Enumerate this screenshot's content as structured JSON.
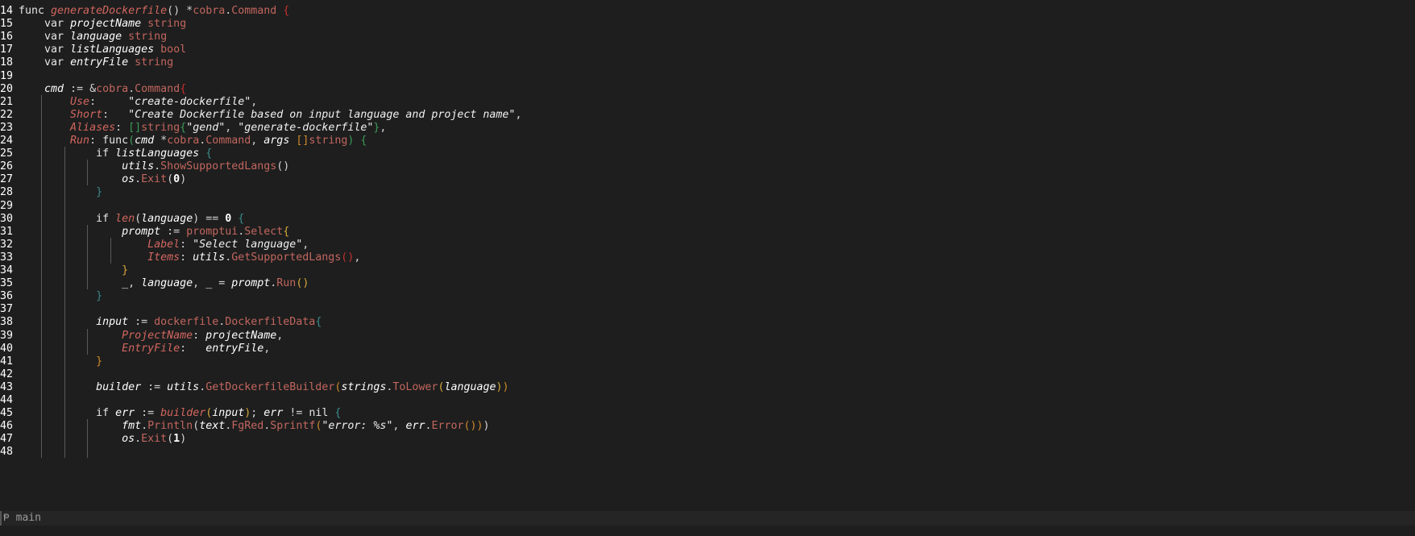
{
  "editor": {
    "language": "go",
    "lines": [
      {
        "n": "14",
        "indent": 0,
        "tokens": [
          [
            "kw",
            "func "
          ],
          [
            "fn",
            "generateDockerfile"
          ],
          [
            "pun",
            "() "
          ],
          [
            "op",
            "*"
          ],
          [
            "pkg",
            "cobra"
          ],
          [
            "pun",
            "."
          ],
          [
            "typ",
            "Command"
          ],
          [
            "b-red",
            " {"
          ]
        ]
      },
      {
        "n": "15",
        "indent": 1,
        "tokens": [
          [
            "kw",
            "var "
          ],
          [
            "var",
            "projectName "
          ],
          [
            "typ",
            "string"
          ]
        ]
      },
      {
        "n": "16",
        "indent": 1,
        "tokens": [
          [
            "kw",
            "var "
          ],
          [
            "var",
            "language "
          ],
          [
            "typ",
            "string"
          ]
        ]
      },
      {
        "n": "17",
        "indent": 1,
        "tokens": [
          [
            "kw",
            "var "
          ],
          [
            "var",
            "listLanguages "
          ],
          [
            "typ",
            "bool"
          ]
        ]
      },
      {
        "n": "18",
        "indent": 1,
        "tokens": [
          [
            "kw",
            "var "
          ],
          [
            "var",
            "entryFile "
          ],
          [
            "typ",
            "string"
          ]
        ]
      },
      {
        "n": "19",
        "indent": 0,
        "tokens": []
      },
      {
        "n": "20",
        "indent": 1,
        "tokens": [
          [
            "var",
            "cmd "
          ],
          [
            "op",
            ":= &"
          ],
          [
            "pkg",
            "cobra"
          ],
          [
            "pun",
            "."
          ],
          [
            "typ",
            "Command"
          ],
          [
            "b-red",
            "{"
          ]
        ]
      },
      {
        "n": "21",
        "indent": 2,
        "tokens": [
          [
            "fld",
            "Use"
          ],
          [
            "pun",
            ":     "
          ],
          [
            "str",
            "\"create-dockerfile\""
          ],
          [
            "pun",
            ","
          ]
        ]
      },
      {
        "n": "22",
        "indent": 2,
        "tokens": [
          [
            "fld",
            "Short"
          ],
          [
            "pun",
            ":   "
          ],
          [
            "str",
            "\"Create Dockerfile based on input language and project name\""
          ],
          [
            "pun",
            ","
          ]
        ]
      },
      {
        "n": "23",
        "indent": 2,
        "tokens": [
          [
            "fld",
            "Aliases"
          ],
          [
            "pun",
            ": "
          ],
          [
            "b-green",
            "[]"
          ],
          [
            "typ",
            "string"
          ],
          [
            "b-green",
            "{"
          ],
          [
            "str",
            "\"gend\""
          ],
          [
            "pun",
            ", "
          ],
          [
            "str",
            "\"generate-dockerfile\""
          ],
          [
            "b-green",
            "}"
          ],
          [
            "pun",
            ","
          ]
        ]
      },
      {
        "n": "24",
        "indent": 2,
        "tokens": [
          [
            "fld",
            "Run"
          ],
          [
            "pun",
            ": "
          ],
          [
            "kw",
            "func"
          ],
          [
            "b-green",
            "("
          ],
          [
            "var",
            "cmd "
          ],
          [
            "op",
            "*"
          ],
          [
            "pkg",
            "cobra"
          ],
          [
            "pun",
            "."
          ],
          [
            "typ",
            "Command"
          ],
          [
            "pun",
            ", "
          ],
          [
            "var",
            "args "
          ],
          [
            "b-orange",
            "[]"
          ],
          [
            "typ",
            "string"
          ],
          [
            "b-green",
            ")"
          ],
          [
            "b-green",
            " {"
          ]
        ]
      },
      {
        "n": "25",
        "indent": 3,
        "tokens": [
          [
            "kw",
            "if "
          ],
          [
            "var",
            "listLanguages "
          ],
          [
            "b-teal",
            "{"
          ]
        ]
      },
      {
        "n": "26",
        "indent": 4,
        "tokens": [
          [
            "var",
            "utils"
          ],
          [
            "pun",
            "."
          ],
          [
            "call",
            "ShowSupportedLangs"
          ],
          [
            "pun",
            "()"
          ]
        ]
      },
      {
        "n": "27",
        "indent": 4,
        "tokens": [
          [
            "var",
            "os"
          ],
          [
            "pun",
            "."
          ],
          [
            "call",
            "Exit"
          ],
          [
            "pun",
            "("
          ],
          [
            "num",
            "0"
          ],
          [
            "pun",
            ")"
          ]
        ]
      },
      {
        "n": "28",
        "indent": 3,
        "tokens": [
          [
            "b-teal",
            "}"
          ]
        ]
      },
      {
        "n": "29",
        "indent": 0,
        "tokens": []
      },
      {
        "n": "30",
        "indent": 3,
        "tokens": [
          [
            "kw",
            "if "
          ],
          [
            "fn",
            "len"
          ],
          [
            "pun",
            "("
          ],
          [
            "var",
            "language"
          ],
          [
            "pun",
            ") == "
          ],
          [
            "num",
            "0"
          ],
          [
            "b-teal",
            " {"
          ]
        ]
      },
      {
        "n": "31",
        "indent": 4,
        "tokens": [
          [
            "var",
            "prompt "
          ],
          [
            "op",
            ":= "
          ],
          [
            "pkg",
            "promptui"
          ],
          [
            "pun",
            "."
          ],
          [
            "call",
            "Select"
          ],
          [
            "b-yellow",
            "{"
          ]
        ]
      },
      {
        "n": "32",
        "indent": 5,
        "tokens": [
          [
            "fld",
            "Label"
          ],
          [
            "pun",
            ": "
          ],
          [
            "str",
            "\"Select language\""
          ],
          [
            "pun",
            ","
          ]
        ]
      },
      {
        "n": "33",
        "indent": 5,
        "tokens": [
          [
            "fld",
            "Items"
          ],
          [
            "pun",
            ": "
          ],
          [
            "var",
            "utils"
          ],
          [
            "pun",
            "."
          ],
          [
            "call",
            "GetSupportedLangs"
          ],
          [
            "b-red",
            "()"
          ],
          [
            "pun",
            ","
          ]
        ]
      },
      {
        "n": "34",
        "indent": 4,
        "tokens": [
          [
            "b-yellow",
            "}"
          ]
        ]
      },
      {
        "n": "35",
        "indent": 4,
        "tokens": [
          [
            "var",
            "_"
          ],
          [
            "pun",
            ", "
          ],
          [
            "var",
            "language"
          ],
          [
            "pun",
            ", "
          ],
          [
            "var",
            "_ "
          ],
          [
            "op",
            "= "
          ],
          [
            "var",
            "prompt"
          ],
          [
            "pun",
            "."
          ],
          [
            "call",
            "Run"
          ],
          [
            "b-yellow",
            "()"
          ]
        ]
      },
      {
        "n": "36",
        "indent": 3,
        "tokens": [
          [
            "b-teal",
            "}"
          ]
        ]
      },
      {
        "n": "37",
        "indent": 0,
        "tokens": []
      },
      {
        "n": "38",
        "indent": 3,
        "tokens": [
          [
            "var",
            "input "
          ],
          [
            "op",
            ":= "
          ],
          [
            "pkg",
            "dockerfile"
          ],
          [
            "pun",
            "."
          ],
          [
            "typ",
            "DockerfileData"
          ],
          [
            "b-teal",
            "{"
          ]
        ]
      },
      {
        "n": "39",
        "indent": 4,
        "tokens": [
          [
            "fld",
            "ProjectName"
          ],
          [
            "pun",
            ": "
          ],
          [
            "var",
            "projectName"
          ],
          [
            "pun",
            ","
          ]
        ]
      },
      {
        "n": "40",
        "indent": 4,
        "tokens": [
          [
            "fld",
            "EntryFile"
          ],
          [
            "pun",
            ":   "
          ],
          [
            "var",
            "entryFile"
          ],
          [
            "pun",
            ","
          ]
        ]
      },
      {
        "n": "41",
        "indent": 3,
        "tokens": [
          [
            "b-orange",
            "}"
          ]
        ]
      },
      {
        "n": "42",
        "indent": 0,
        "tokens": []
      },
      {
        "n": "43",
        "indent": 3,
        "tokens": [
          [
            "var",
            "builder "
          ],
          [
            "op",
            ":= "
          ],
          [
            "var",
            "utils"
          ],
          [
            "pun",
            "."
          ],
          [
            "call",
            "GetDockerfileBuilder"
          ],
          [
            "b-orange",
            "("
          ],
          [
            "var",
            "strings"
          ],
          [
            "pun",
            "."
          ],
          [
            "call",
            "ToLower"
          ],
          [
            "b-yellow",
            "("
          ],
          [
            "var",
            "language"
          ],
          [
            "b-yellow",
            ")"
          ],
          [
            "b-orange",
            ")"
          ]
        ]
      },
      {
        "n": "44",
        "indent": 0,
        "tokens": []
      },
      {
        "n": "45",
        "indent": 3,
        "tokens": [
          [
            "kw",
            "if "
          ],
          [
            "var",
            "err "
          ],
          [
            "op",
            ":= "
          ],
          [
            "fn",
            "builder"
          ],
          [
            "b-yellow",
            "("
          ],
          [
            "var",
            "input"
          ],
          [
            "b-yellow",
            ")"
          ],
          [
            "pun",
            "; "
          ],
          [
            "var",
            "err "
          ],
          [
            "op",
            "!= "
          ],
          [
            "kw",
            "nil"
          ],
          [
            "b-teal",
            " {"
          ]
        ]
      },
      {
        "n": "46",
        "indent": 4,
        "tokens": [
          [
            "var",
            "fmt"
          ],
          [
            "pun",
            "."
          ],
          [
            "call",
            "Println"
          ],
          [
            "pun",
            "("
          ],
          [
            "var",
            "text"
          ],
          [
            "pun",
            "."
          ],
          [
            "call",
            "FgRed"
          ],
          [
            "pun",
            "."
          ],
          [
            "call",
            "Sprintf"
          ],
          [
            "b-orange",
            "("
          ],
          [
            "str",
            "\"error: %s\""
          ],
          [
            "pun",
            ", "
          ],
          [
            "var",
            "err"
          ],
          [
            "pun",
            "."
          ],
          [
            "call",
            "Error"
          ],
          [
            "b-orange",
            "()"
          ],
          [
            "b-orange",
            ")"
          ],
          [
            "pun",
            ")"
          ]
        ]
      },
      {
        "n": "47",
        "indent": 4,
        "tokens": [
          [
            "var",
            "os"
          ],
          [
            "pun",
            "."
          ],
          [
            "call",
            "Exit"
          ],
          [
            "pun",
            "("
          ],
          [
            "num",
            "1"
          ],
          [
            "pun",
            ")"
          ]
        ]
      },
      {
        "n": "48",
        "indent": 4,
        "tokens": []
      }
    ]
  },
  "statusbar": {
    "branch_icon": "git-branch-icon",
    "branch_glyph": "Ᵽ",
    "branch_name": "main"
  }
}
